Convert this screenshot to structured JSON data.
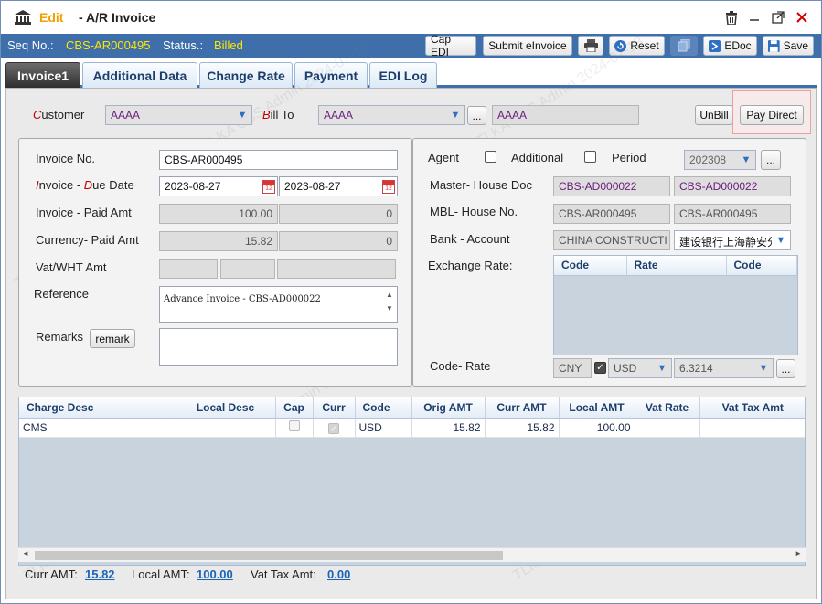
{
  "window": {
    "mode": "Edit",
    "title": "- A/R Invoice"
  },
  "toolbar": {
    "seq_label": "Seq No.:",
    "seq_value": "CBS-AR000495",
    "status_label": "Status.:",
    "status_value": "Billed",
    "cap_edi": "Cap EDI",
    "submit_einvoice": "Submit eInvoice",
    "reset": "Reset",
    "edoc": "EDoc",
    "save": "Save"
  },
  "tabs": [
    "Invoice1",
    "Additional Data",
    "Change Rate",
    "Payment",
    "EDI Log"
  ],
  "header": {
    "customer_label_first": "C",
    "customer_label_rest": "ustomer",
    "customer_value": "AAAA",
    "billto_label_first": "B",
    "billto_label_rest": "ill To",
    "billto_value": "AAAA",
    "billto_text": "AAAA",
    "more": "...",
    "unbill": "UnBill",
    "pay_direct": "Pay Direct"
  },
  "left": {
    "invoice_no_label": "Invoice No.",
    "invoice_no": "CBS-AR000495",
    "inv_due_label_a": "I",
    "inv_due_label_b": "nvoice - ",
    "inv_due_label_c": "D",
    "inv_due_label_d": "ue Date",
    "invoice_date": "2023-08-27",
    "due_date": "2023-08-27",
    "paid_label": "Invoice - Paid Amt",
    "invoice_amt": "100.00",
    "paid_amt": "0",
    "currency_label": "Currency- Paid Amt",
    "currency_amt": "15.82",
    "currency_paid": "0",
    "vat_label": "Vat/WHT Amt",
    "reference_label": "Reference",
    "reference": "Advance Invoice - CBS-AD000022",
    "remarks_label": "Remarks",
    "remark_btn": "remark"
  },
  "right": {
    "agent": "Agent",
    "additional": "Additional",
    "period": "Period",
    "period_value": "202308",
    "more": "...",
    "master_label": "Master- House Doc",
    "master_doc": "CBS-AD000022",
    "house_doc": "CBS-AD000022",
    "mbl_label": "MBL- House No.",
    "mbl_no": "CBS-AR000495",
    "house_no": "CBS-AR000495",
    "bank_label": "Bank -  Account",
    "bank": "CHINA CONSTRUCTI",
    "account": "建设银行上海静安分",
    "exchange_label": "Exchange Rate:",
    "exchange_cols": [
      "Code",
      "Rate",
      "Code"
    ],
    "code_rate_label": "Code- Rate",
    "cny": "CNY",
    "usd": "USD",
    "rate": "6.3214"
  },
  "grid": {
    "columns": [
      "Charge Desc",
      "Local Desc",
      "Cap",
      "Curr",
      "Code",
      "Orig AMT",
      "Curr AMT",
      "Local AMT",
      "Vat Rate",
      "Vat Tax Amt"
    ],
    "rows": [
      {
        "charge_desc": "CMS",
        "local_desc": "",
        "cap": false,
        "curr": true,
        "code": "USD",
        "orig_amt": "15.82",
        "curr_amt": "15.82",
        "local_amt": "100.00",
        "vat_rate": "",
        "vat_tax": ""
      }
    ]
  },
  "totals": {
    "curr_label": "Curr AMT:",
    "curr": "15.82",
    "local_label": "Local AMT:",
    "local": "100.00",
    "vat_label": "Vat Tax Amt:",
    "vat": "0.00"
  },
  "watermark": [
    "TLKA CBS Admin 2024-07-18"
  ],
  "colors": {
    "accent": "#3f6faa",
    "status": "#ffe600",
    "label_required": "#c00000",
    "close": "#d40000"
  }
}
